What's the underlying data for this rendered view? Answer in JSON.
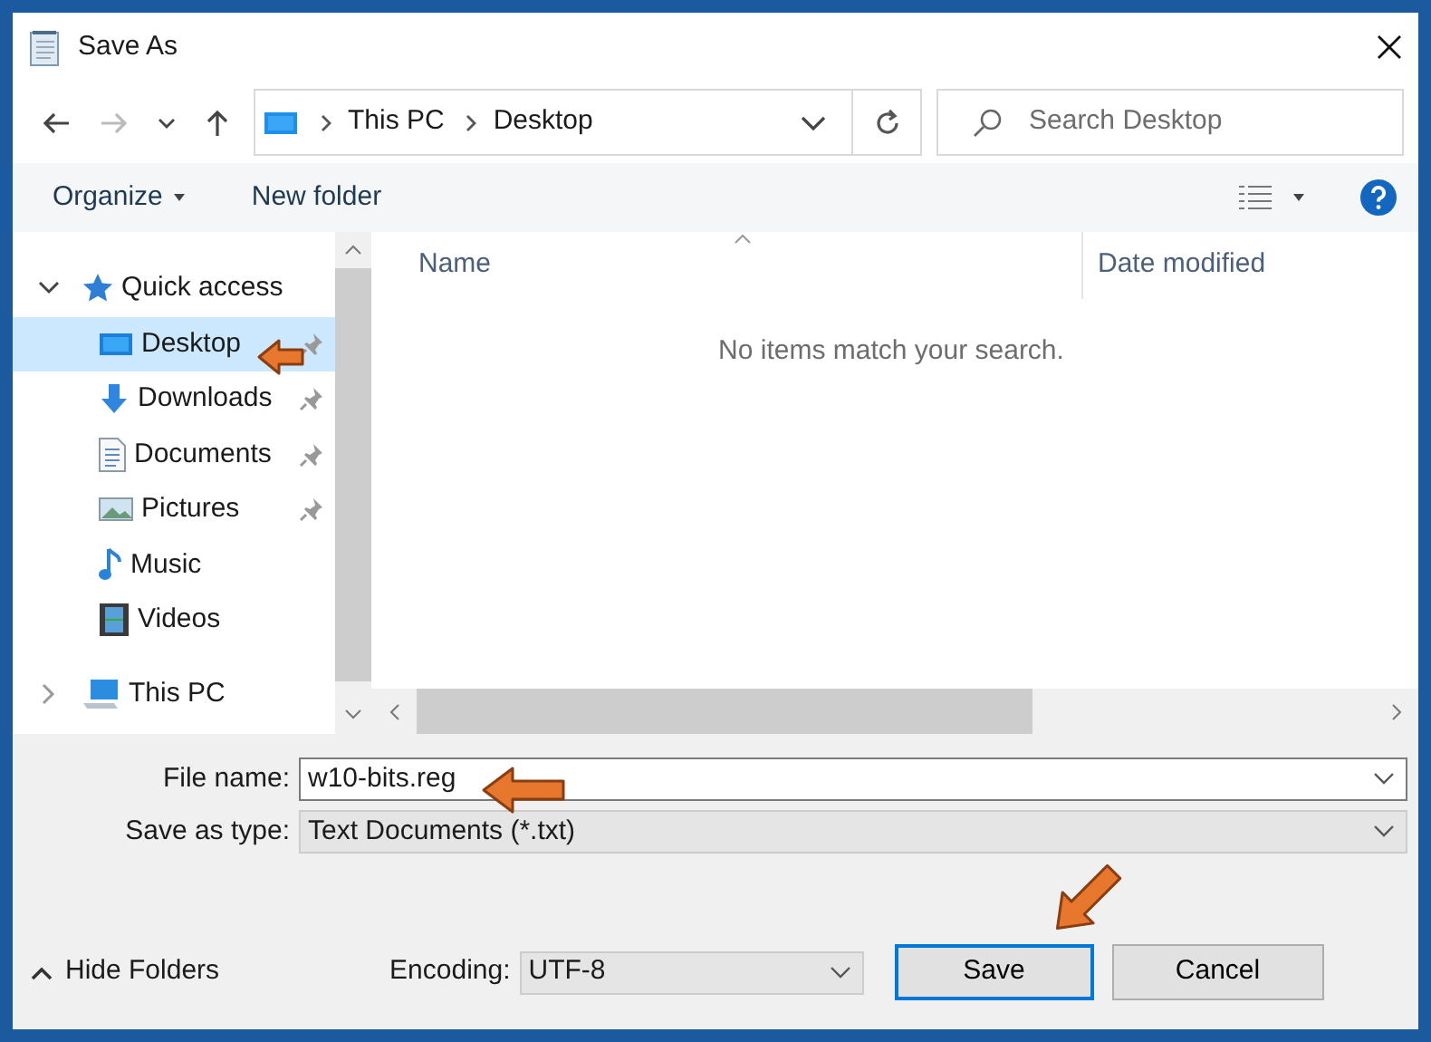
{
  "window": {
    "title": "Save As"
  },
  "address_bar": {
    "path": [
      "This PC",
      "Desktop"
    ]
  },
  "search": {
    "placeholder": "Search Desktop"
  },
  "toolbar": {
    "organize": "Organize",
    "new_folder": "New folder"
  },
  "sidebar": {
    "items": [
      {
        "label": "Quick access",
        "kind": "quick",
        "expanded": true,
        "selected": false,
        "children": [
          {
            "label": "Desktop",
            "kind": "desktop",
            "pinned": true,
            "selected": true
          },
          {
            "label": "Downloads",
            "kind": "downloads",
            "pinned": true,
            "selected": false
          },
          {
            "label": "Documents",
            "kind": "documents",
            "pinned": true,
            "selected": false
          },
          {
            "label": "Pictures",
            "kind": "pictures",
            "pinned": true,
            "selected": false
          },
          {
            "label": "Music",
            "kind": "music",
            "pinned": false,
            "selected": false
          },
          {
            "label": "Videos",
            "kind": "videos",
            "pinned": false,
            "selected": false
          }
        ]
      },
      {
        "label": "This PC",
        "kind": "pc",
        "expanded": false,
        "selected": false
      }
    ]
  },
  "file_list": {
    "columns": [
      "Name",
      "Date modified"
    ],
    "empty_message": "No items match your search."
  },
  "form": {
    "file_name_label": "File name:",
    "file_name": "w10-bits.reg",
    "type_label": "Save as type:",
    "type": "Text Documents (*.txt)"
  },
  "footer": {
    "hide_folders": "Hide Folders",
    "encoding_label": "Encoding:",
    "encoding": "UTF-8",
    "buttons": [
      {
        "label": "Save",
        "default": true
      },
      {
        "label": "Cancel",
        "default": false
      }
    ]
  }
}
